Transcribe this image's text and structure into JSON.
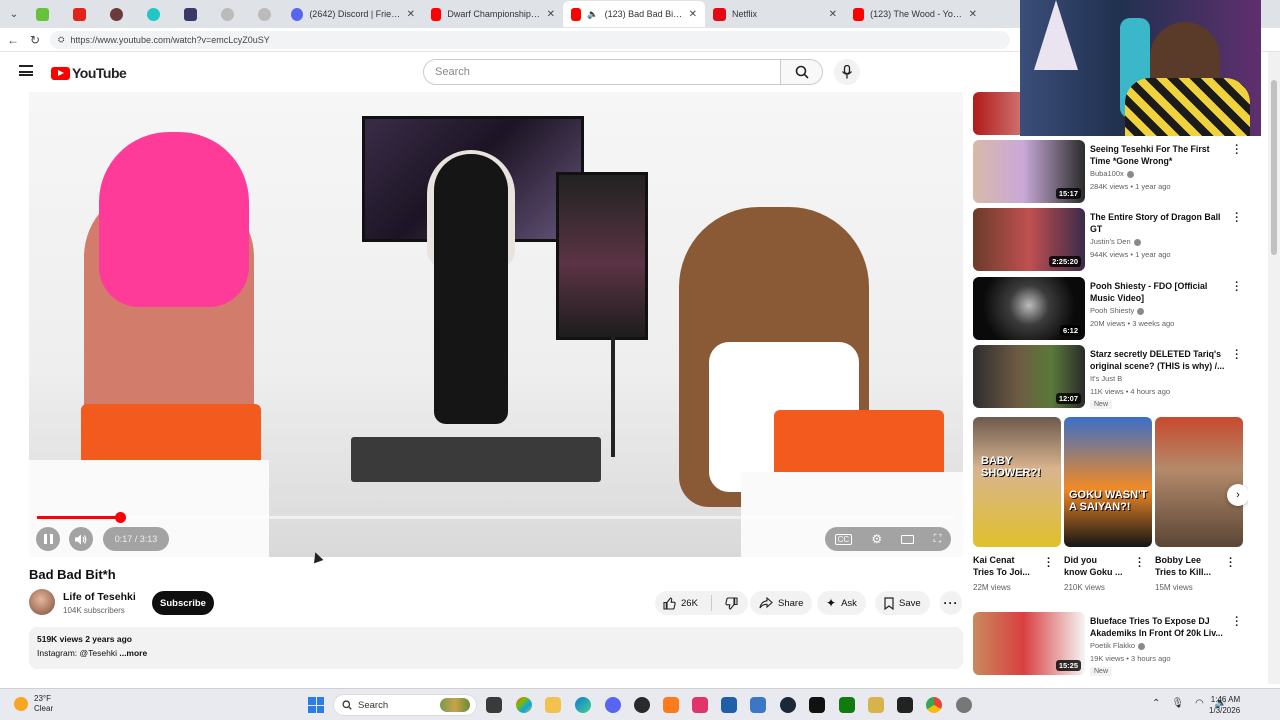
{
  "browser": {
    "tabs": [
      {
        "title": "(2642) Discord | Friends",
        "color": "#5865f2"
      },
      {
        "title": "Dwarf Championship KO - Yo",
        "color": "#ff0000"
      },
      {
        "title": "(123) Bad Bad Bit*h - Yo",
        "color": "#ff0000",
        "active": true
      },
      {
        "title": "Netflix",
        "color": "#e50914"
      },
      {
        "title": "(123) The Wood - YouTube",
        "color": "#ff0000"
      }
    ],
    "url": "https://www.youtube.com/watch?v=emcLcyZ0uSY"
  },
  "header": {
    "logo_text": "YouTube",
    "search_placeholder": "Search"
  },
  "player": {
    "time": "0:17 / 3:13",
    "progress": 0.09
  },
  "video": {
    "title": "Bad Bad Bit*h",
    "channel": "Life of Tesehki",
    "subscribers": "104K subscribers",
    "subscribe_label": "Subscribe",
    "likes": "26K",
    "share_label": "Share",
    "ask_label": "Ask",
    "save_label": "Save",
    "description": {
      "meta": "519K views  2 years ago",
      "text": "Instagram: @Tesehki",
      "more": "...more"
    }
  },
  "sidebar": {
    "videos": [
      {
        "title": "Seeing Tesehki For The First Time *Gone Wrong*",
        "channel": "Buba100x",
        "meta": "284K views • 1 year ago",
        "duration": "15:17",
        "verified": true
      },
      {
        "title": "The Entire Story of Dragon Ball GT",
        "channel": "Justin's Den",
        "meta": "944K views • 1 year ago",
        "duration": "2:25:20",
        "verified": true
      },
      {
        "title": "Pooh Shiesty - FDO [Official Music Video]",
        "channel": "Pooh Shiesty",
        "meta": "20M views • 3 weeks ago",
        "duration": "6:12",
        "verified": true
      },
      {
        "title": "Starz secretly DELETED Tariq's original scene? (THIS is why) /...",
        "channel": "It's Just B",
        "meta": "11K views • 4 hours ago",
        "duration": "12:07",
        "badge": "New"
      },
      {
        "title": "Blueface Tries To Expose DJ Akademiks In Front Of 20k Liv...",
        "channel": "Poetik Flakko",
        "meta": "19K views • 3 hours ago",
        "duration": "15:25",
        "verified": true,
        "badge": "New"
      }
    ],
    "shorts": [
      {
        "line1": "Kai Cenat",
        "line2": "Tries To Joi...",
        "views": "22M views",
        "thumb_text": "BABY SHOWER?!"
      },
      {
        "line1": "Did you",
        "line2": "know Goku ...",
        "views": "210K views",
        "thumb_text": "GOKU WASN'T A SAIYAN?!"
      },
      {
        "line1": "Bobby Lee",
        "line2": "Tries to Kill...",
        "views": "15M views",
        "thumb_text": ""
      }
    ]
  },
  "taskbar": {
    "weather_temp": "23°F",
    "weather_desc": "Clear",
    "search_label": "Search",
    "time": "1:46 AM",
    "date": "1/3/2026"
  }
}
